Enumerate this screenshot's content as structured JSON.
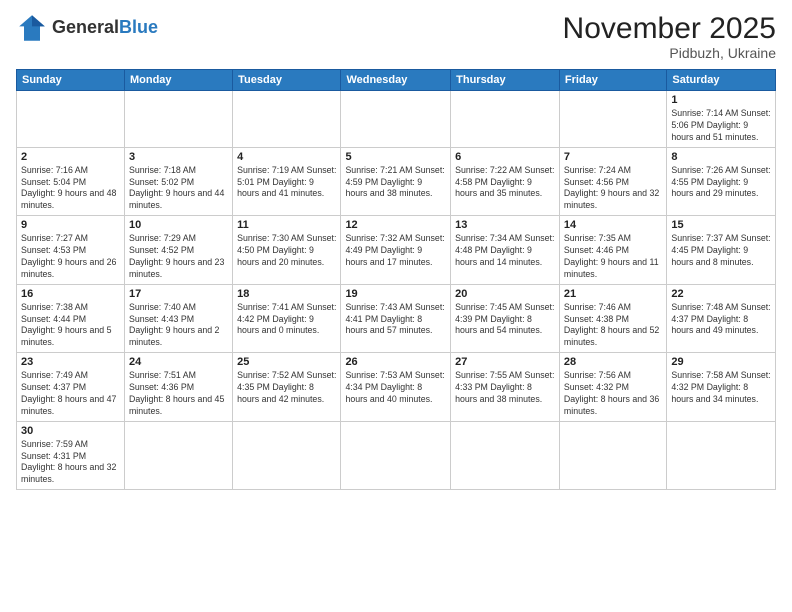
{
  "logo": {
    "text_general": "General",
    "text_blue": "Blue"
  },
  "title": "November 2025",
  "subtitle": "Pidbuzh, Ukraine",
  "weekdays": [
    "Sunday",
    "Monday",
    "Tuesday",
    "Wednesday",
    "Thursday",
    "Friday",
    "Saturday"
  ],
  "weeks": [
    [
      {
        "day": "",
        "info": ""
      },
      {
        "day": "",
        "info": ""
      },
      {
        "day": "",
        "info": ""
      },
      {
        "day": "",
        "info": ""
      },
      {
        "day": "",
        "info": ""
      },
      {
        "day": "",
        "info": ""
      },
      {
        "day": "1",
        "info": "Sunrise: 7:14 AM\nSunset: 5:06 PM\nDaylight: 9 hours\nand 51 minutes."
      }
    ],
    [
      {
        "day": "2",
        "info": "Sunrise: 7:16 AM\nSunset: 5:04 PM\nDaylight: 9 hours\nand 48 minutes."
      },
      {
        "day": "3",
        "info": "Sunrise: 7:18 AM\nSunset: 5:02 PM\nDaylight: 9 hours\nand 44 minutes."
      },
      {
        "day": "4",
        "info": "Sunrise: 7:19 AM\nSunset: 5:01 PM\nDaylight: 9 hours\nand 41 minutes."
      },
      {
        "day": "5",
        "info": "Sunrise: 7:21 AM\nSunset: 4:59 PM\nDaylight: 9 hours\nand 38 minutes."
      },
      {
        "day": "6",
        "info": "Sunrise: 7:22 AM\nSunset: 4:58 PM\nDaylight: 9 hours\nand 35 minutes."
      },
      {
        "day": "7",
        "info": "Sunrise: 7:24 AM\nSunset: 4:56 PM\nDaylight: 9 hours\nand 32 minutes."
      },
      {
        "day": "8",
        "info": "Sunrise: 7:26 AM\nSunset: 4:55 PM\nDaylight: 9 hours\nand 29 minutes."
      }
    ],
    [
      {
        "day": "9",
        "info": "Sunrise: 7:27 AM\nSunset: 4:53 PM\nDaylight: 9 hours\nand 26 minutes."
      },
      {
        "day": "10",
        "info": "Sunrise: 7:29 AM\nSunset: 4:52 PM\nDaylight: 9 hours\nand 23 minutes."
      },
      {
        "day": "11",
        "info": "Sunrise: 7:30 AM\nSunset: 4:50 PM\nDaylight: 9 hours\nand 20 minutes."
      },
      {
        "day": "12",
        "info": "Sunrise: 7:32 AM\nSunset: 4:49 PM\nDaylight: 9 hours\nand 17 minutes."
      },
      {
        "day": "13",
        "info": "Sunrise: 7:34 AM\nSunset: 4:48 PM\nDaylight: 9 hours\nand 14 minutes."
      },
      {
        "day": "14",
        "info": "Sunrise: 7:35 AM\nSunset: 4:46 PM\nDaylight: 9 hours\nand 11 minutes."
      },
      {
        "day": "15",
        "info": "Sunrise: 7:37 AM\nSunset: 4:45 PM\nDaylight: 9 hours\nand 8 minutes."
      }
    ],
    [
      {
        "day": "16",
        "info": "Sunrise: 7:38 AM\nSunset: 4:44 PM\nDaylight: 9 hours\nand 5 minutes."
      },
      {
        "day": "17",
        "info": "Sunrise: 7:40 AM\nSunset: 4:43 PM\nDaylight: 9 hours\nand 2 minutes."
      },
      {
        "day": "18",
        "info": "Sunrise: 7:41 AM\nSunset: 4:42 PM\nDaylight: 9 hours\nand 0 minutes."
      },
      {
        "day": "19",
        "info": "Sunrise: 7:43 AM\nSunset: 4:41 PM\nDaylight: 8 hours\nand 57 minutes."
      },
      {
        "day": "20",
        "info": "Sunrise: 7:45 AM\nSunset: 4:39 PM\nDaylight: 8 hours\nand 54 minutes."
      },
      {
        "day": "21",
        "info": "Sunrise: 7:46 AM\nSunset: 4:38 PM\nDaylight: 8 hours\nand 52 minutes."
      },
      {
        "day": "22",
        "info": "Sunrise: 7:48 AM\nSunset: 4:37 PM\nDaylight: 8 hours\nand 49 minutes."
      }
    ],
    [
      {
        "day": "23",
        "info": "Sunrise: 7:49 AM\nSunset: 4:37 PM\nDaylight: 8 hours\nand 47 minutes."
      },
      {
        "day": "24",
        "info": "Sunrise: 7:51 AM\nSunset: 4:36 PM\nDaylight: 8 hours\nand 45 minutes."
      },
      {
        "day": "25",
        "info": "Sunrise: 7:52 AM\nSunset: 4:35 PM\nDaylight: 8 hours\nand 42 minutes."
      },
      {
        "day": "26",
        "info": "Sunrise: 7:53 AM\nSunset: 4:34 PM\nDaylight: 8 hours\nand 40 minutes."
      },
      {
        "day": "27",
        "info": "Sunrise: 7:55 AM\nSunset: 4:33 PM\nDaylight: 8 hours\nand 38 minutes."
      },
      {
        "day": "28",
        "info": "Sunrise: 7:56 AM\nSunset: 4:32 PM\nDaylight: 8 hours\nand 36 minutes."
      },
      {
        "day": "29",
        "info": "Sunrise: 7:58 AM\nSunset: 4:32 PM\nDaylight: 8 hours\nand 34 minutes."
      }
    ],
    [
      {
        "day": "30",
        "info": "Sunrise: 7:59 AM\nSunset: 4:31 PM\nDaylight: 8 hours\nand 32 minutes."
      },
      {
        "day": "",
        "info": ""
      },
      {
        "day": "",
        "info": ""
      },
      {
        "day": "",
        "info": ""
      },
      {
        "day": "",
        "info": ""
      },
      {
        "day": "",
        "info": ""
      },
      {
        "day": "",
        "info": ""
      }
    ]
  ]
}
